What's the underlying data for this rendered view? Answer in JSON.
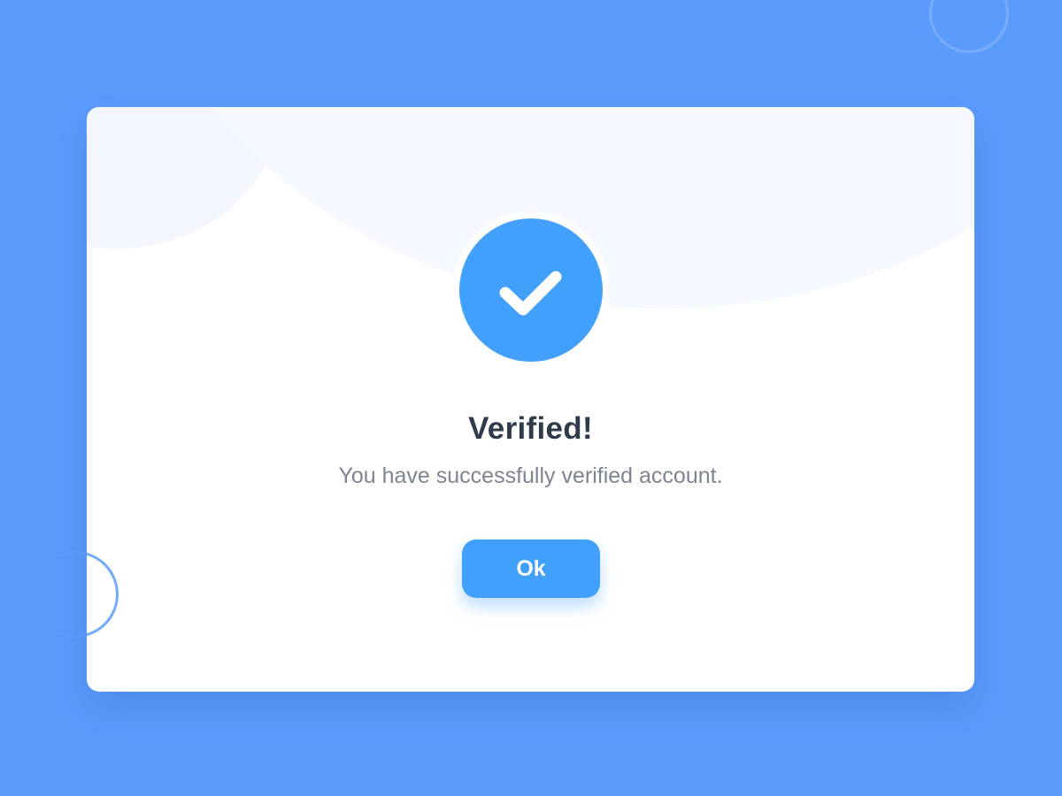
{
  "dialog": {
    "icon": "check-icon",
    "title": "Verified!",
    "message": "You have successfully verified account.",
    "ok_label": "Ok"
  },
  "colors": {
    "background": "#5a9bfc",
    "accent": "#42a0fd",
    "title": "#2f3a4b",
    "message": "#7c8591",
    "card": "#ffffff"
  }
}
